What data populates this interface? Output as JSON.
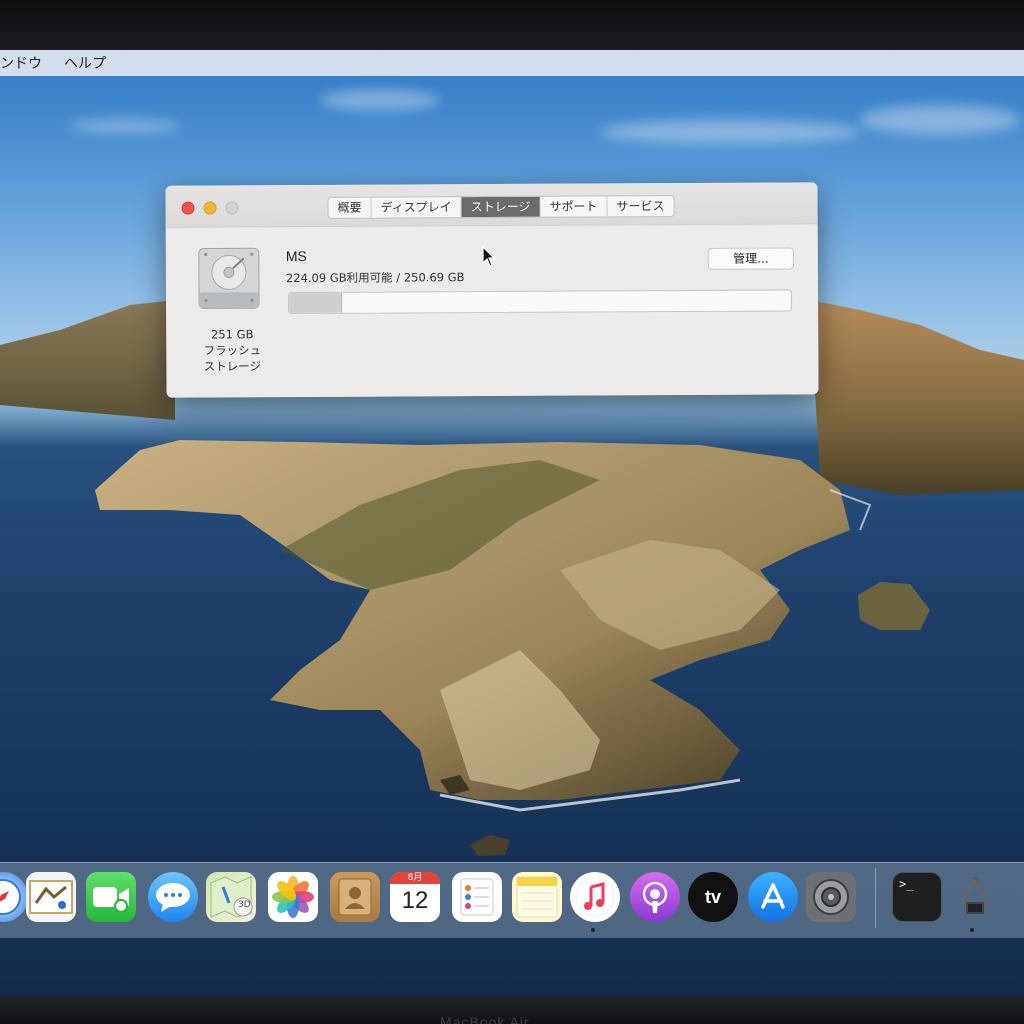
{
  "menubar": {
    "items": [
      "ンドウ",
      "ヘルプ"
    ]
  },
  "window": {
    "tabs": [
      "概要",
      "ディスプレイ",
      "ストレージ",
      "サポート",
      "サービス"
    ],
    "active_tab_index": 2,
    "disk": {
      "size": "251 GB",
      "type_line1": "フラッシュ",
      "type_line2": "ストレージ"
    },
    "volume": {
      "name": "MS",
      "info": "224.09 GB利用可能 / 250.69 GB",
      "used_fraction": 0.106
    },
    "manage_button": "管理..."
  },
  "dock": {
    "items": [
      {
        "name": "safari-icon"
      },
      {
        "name": "mail-icon"
      },
      {
        "name": "facetime-icon"
      },
      {
        "name": "messages-icon"
      },
      {
        "name": "maps-icon",
        "label": "3D"
      },
      {
        "name": "photos-icon"
      },
      {
        "name": "contacts-icon"
      },
      {
        "name": "calendar-icon",
        "month": "8月",
        "day": "12"
      },
      {
        "name": "reminders-icon"
      },
      {
        "name": "notes-icon"
      },
      {
        "name": "music-icon"
      },
      {
        "name": "podcasts-icon"
      },
      {
        "name": "tv-icon",
        "label": "tv"
      },
      {
        "name": "app-store-icon"
      },
      {
        "name": "system-preferences-icon"
      },
      {
        "name": "terminal-icon",
        "label": ">_"
      },
      {
        "name": "system-information-icon"
      }
    ]
  },
  "bezel": {
    "brand": "MacBook Air"
  },
  "colors": {
    "accent_close": "#f2544c",
    "accent_minimize": "#f4b633",
    "active_tab": "#6c6b6a"
  }
}
